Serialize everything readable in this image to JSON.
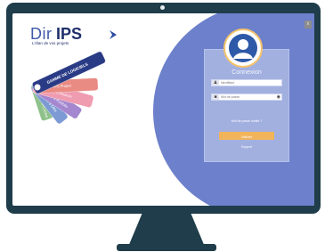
{
  "brand": {
    "name_part1": "Dir",
    "name_part2": "IPS",
    "tagline": "L'élan de vos projets"
  },
  "fan": {
    "cards": [
      {
        "label": "GAMME DE LOGICIELS",
        "color": "#2a3b86"
      },
      {
        "label": "Dir IPS Project",
        "color": "#e98a83"
      },
      {
        "label": "Dir IPS Finance",
        "color": "#ef9bb0"
      },
      {
        "label": "Dir IPS Portfolio",
        "color": "#a487cf"
      },
      {
        "label": "Dir IPS Offre",
        "color": "#7d9ad4"
      },
      {
        "label": "Dir IPS Achat",
        "color": "#8fc18a"
      }
    ]
  },
  "login": {
    "title": "Connexion",
    "username_placeholder": "Identifiant",
    "password_placeholder": "Mot de passe",
    "forgot_link": "Mot de passe oublié ?",
    "submit_label": "Valider",
    "help_link": "Support"
  },
  "window": {
    "close_label": "x"
  },
  "colors": {
    "monitor": "#1f3d4a",
    "panel_blue": "#6c80cb",
    "card": "#a2b0e0",
    "accent_orange": "#f2b45a"
  }
}
